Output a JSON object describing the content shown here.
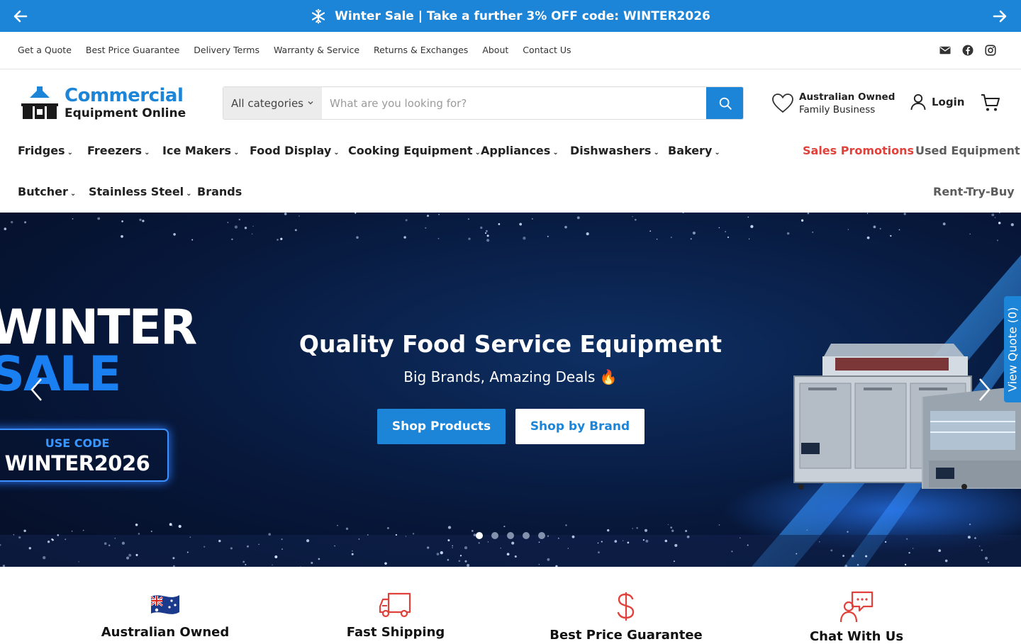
{
  "announcement": {
    "text": "Winter Sale | Take a further 3% OFF code: WINTER2026",
    "icon": "snowflake-icon"
  },
  "top_links": [
    "Get a Quote",
    "Best Price Guarantee",
    "Delivery Terms",
    "Warranty & Service",
    "Returns & Exchanges",
    "About",
    "Contact Us"
  ],
  "social": [
    "mail-icon",
    "facebook-icon",
    "instagram-icon"
  ],
  "logo": {
    "line1": "Commercial",
    "line2": "Equipment Online"
  },
  "search": {
    "category": "All categories",
    "placeholder": "What are you looking for?"
  },
  "badge": {
    "line1": "Australian Owned",
    "line2": "Family Business"
  },
  "account": {
    "login": "Login"
  },
  "nav": {
    "fridges": "Fridges",
    "freezers": "Freezers",
    "ice_makers": "Ice Makers",
    "food_display": "Food Display",
    "cooking": "Cooking Equipment",
    "appliances": "Appliances",
    "dishwashers": "Dishwashers",
    "bakery": "Bakery",
    "promotions": "Sales Promotions",
    "used": "Used Equipment",
    "butcher": "Butcher",
    "stainless": "Stainless Steel",
    "brands": "Brands",
    "rent": "Rent-Try-Buy"
  },
  "hero": {
    "promo_line1": "WINTER",
    "promo_line2": "SALE",
    "code_label": "USE CODE",
    "code": "WINTER2026",
    "title": "Quality Food Service Equipment",
    "subtitle": "Big Brands, Amazing Deals 🔥",
    "btn_primary": "Shop Products",
    "btn_secondary": "Shop by Brand",
    "slide_count": 5,
    "active_slide": 1
  },
  "view_quote": "View Quote (0)",
  "colors": {
    "brand": "#1c85d8",
    "promo": "#e0413a",
    "feature_icon": "#e0413a"
  },
  "features": [
    {
      "icon": "australia-flag-icon",
      "label": "Australian Owned"
    },
    {
      "icon": "truck-icon",
      "label": "Fast Shipping"
    },
    {
      "icon": "dollar-icon",
      "label": "Best Price Guarantee"
    },
    {
      "icon": "chat-icon",
      "label": "Chat With Us"
    }
  ]
}
